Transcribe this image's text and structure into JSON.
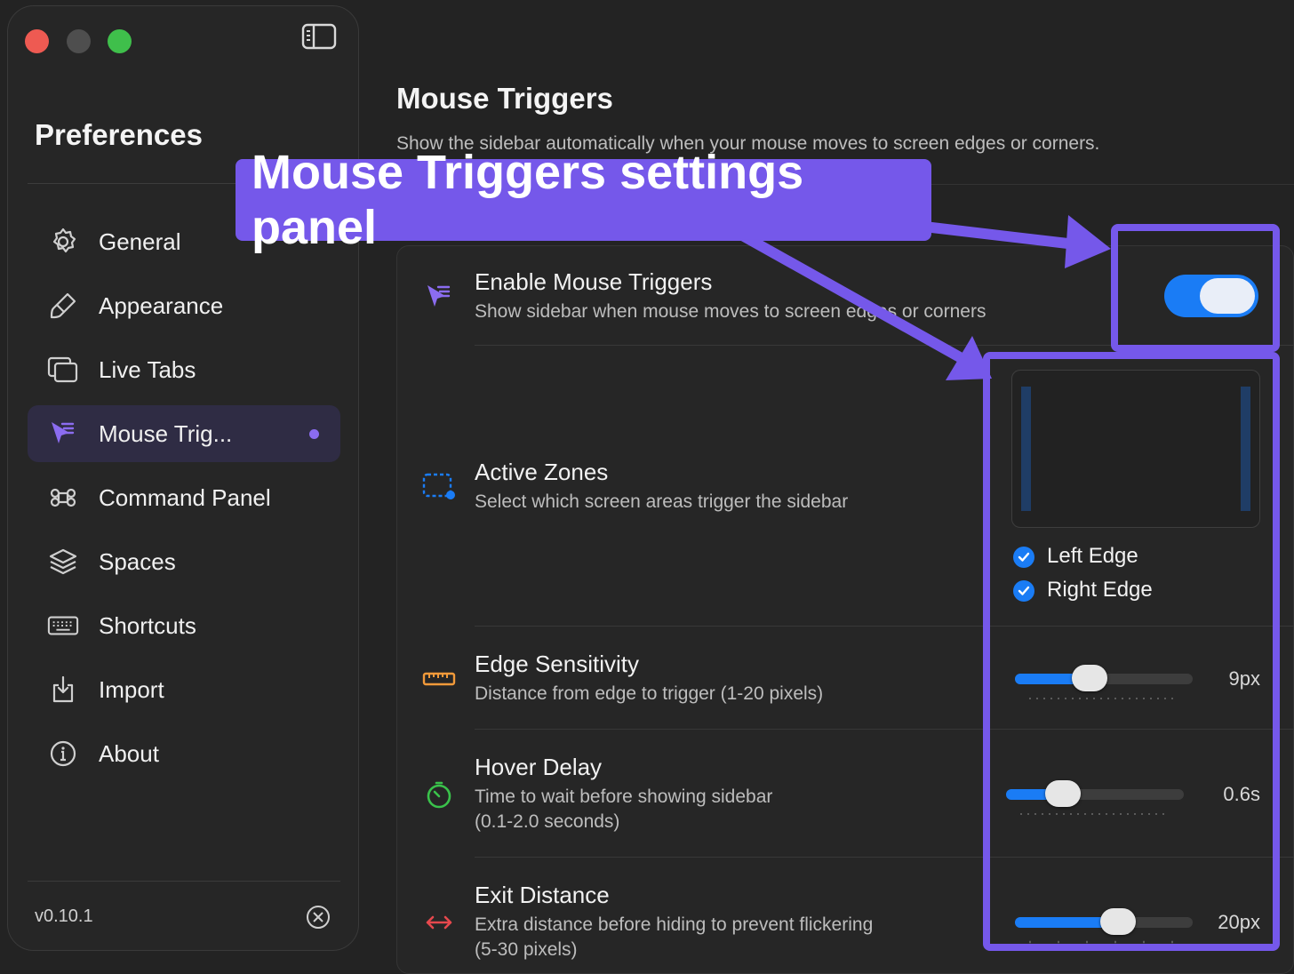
{
  "window": {
    "traffic_lights": {
      "close": "#ee5a52",
      "minimize": "#4e4e4e",
      "zoom": "#3fbf4b"
    },
    "sidebar_toggle_icon": "sidebar-toggle-icon"
  },
  "sidebar": {
    "title": "Preferences",
    "items": [
      {
        "label": "General",
        "icon": "gear-icon"
      },
      {
        "label": "Appearance",
        "icon": "paintbrush-icon"
      },
      {
        "label": "Live Tabs",
        "icon": "tabs-icon"
      },
      {
        "label": "Mouse Trig...",
        "icon": "cursor-icon",
        "active": true
      },
      {
        "label": "Command Panel",
        "icon": "command-icon"
      },
      {
        "label": "Spaces",
        "icon": "layers-icon"
      },
      {
        "label": "Shortcuts",
        "icon": "keyboard-icon"
      },
      {
        "label": "Import",
        "icon": "import-icon"
      },
      {
        "label": "About",
        "icon": "info-icon"
      }
    ],
    "version": "v0.10.1"
  },
  "main": {
    "title": "Mouse Triggers",
    "subtitle": "Show the sidebar automatically when your mouse moves to screen edges or corners.",
    "rows": {
      "enable": {
        "title": "Enable Mouse Triggers",
        "desc": "Show sidebar when mouse moves to screen edges or corners",
        "enabled": true
      },
      "zones": {
        "title": "Active Zones",
        "desc": "Select which screen areas trigger the sidebar",
        "options": [
          "Left Edge",
          "Right Edge"
        ]
      },
      "sensitivity": {
        "title": "Edge Sensitivity",
        "desc": "Distance from edge to trigger (1-20 pixels)",
        "value": "9px",
        "level": 0.42
      },
      "delay": {
        "title": "Hover Delay",
        "desc_line1": "Time to wait before showing sidebar",
        "desc_line2": "(0.1-2.0 seconds)",
        "value": "0.6s",
        "level": 0.32
      },
      "exit": {
        "title": "Exit Distance",
        "desc_line1": "Extra distance before hiding to prevent flickering",
        "desc_line2": "(5-30 pixels)",
        "value": "20px",
        "level": 0.58
      }
    }
  },
  "annotation": {
    "label": "Mouse Triggers settings panel",
    "color": "#7558ea"
  },
  "colors": {
    "accent": "#1a7cf5",
    "highlight": "#7558ea"
  }
}
